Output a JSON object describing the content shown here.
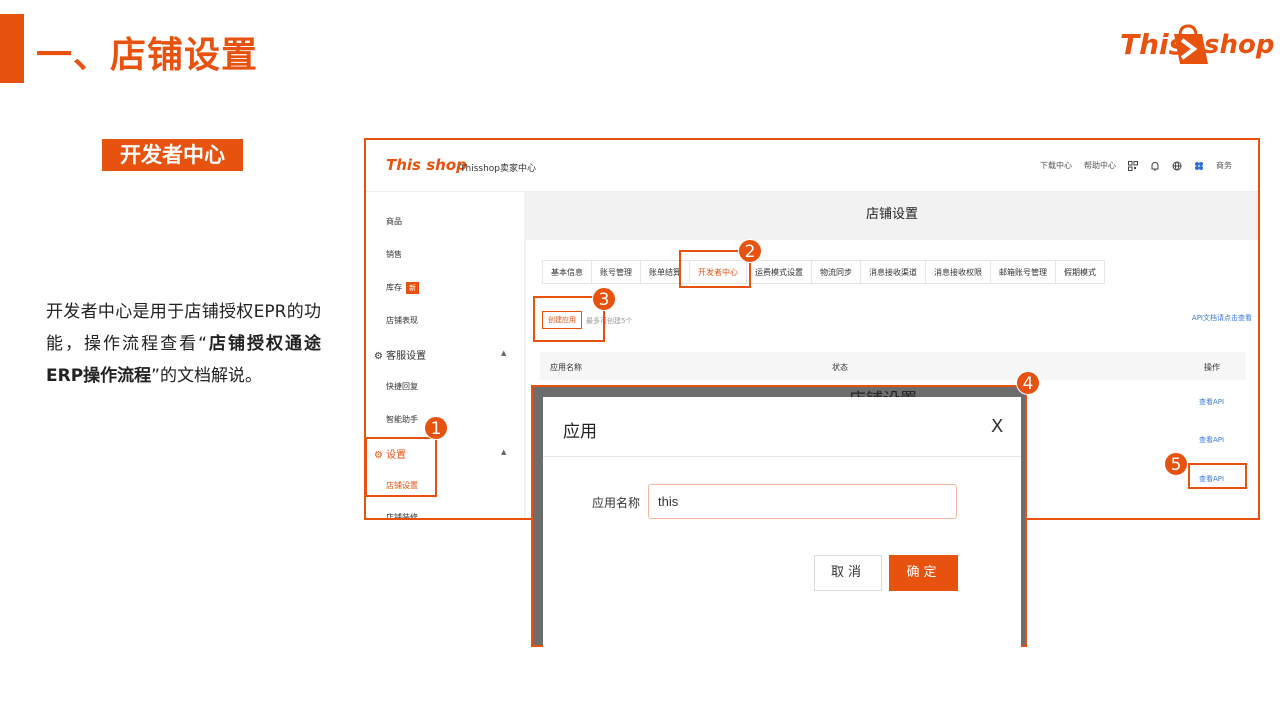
{
  "slide": {
    "title": "一、店铺设置",
    "brand_this": "This",
    "brand_shop": "shop",
    "section_badge": "开发者中心",
    "description_part1": "开发者中心是用于店铺授权EPR的功能，操作流程查看“",
    "description_bold": "店铺授权通途ERP操作流程",
    "description_part2": "”的文档解说。",
    "accent_color": "#e8520f"
  },
  "screenshot": {
    "logo_this": "This",
    "logo_shop": "shop",
    "seller_center": "Thisshop卖家中心",
    "top_links": [
      "下载中心",
      "帮助中心",
      "商务"
    ],
    "top_icons": [
      "qrcode-icon",
      "bell-icon",
      "globe-icon",
      "user-icon"
    ],
    "sidebar": {
      "items": [
        "商品",
        "销售",
        "库存",
        "店铺表现"
      ],
      "stock_badge": "新",
      "group_service": "客服设置",
      "service_items": [
        "快捷回复",
        "智能助手"
      ],
      "group_settings": "设置",
      "settings_items": [
        "店铺设置",
        "店铺装修"
      ]
    },
    "page_title": "店铺设置",
    "tabs": [
      "基本信息",
      "账号管理",
      "账单结算",
      "开发者中心",
      "运费模式设置",
      "物流同步",
      "消息接收渠道",
      "消息接收权限",
      "邮箱账号管理",
      "假期模式"
    ],
    "active_tab": "开发者中心",
    "create_button": "创建应用",
    "create_hint": "最多可创建5个",
    "api_doc_link": "API文档请点击查看",
    "table_headers": [
      "应用名称",
      "状态",
      "操作"
    ],
    "row_action": "查看API"
  },
  "modal": {
    "ghost_title": "店铺设置",
    "title": "应用",
    "close": "X",
    "field_label": "应用名称",
    "field_value": "this",
    "cancel": "取消",
    "confirm": "确定"
  },
  "markers": [
    "1",
    "2",
    "3",
    "4",
    "5"
  ]
}
